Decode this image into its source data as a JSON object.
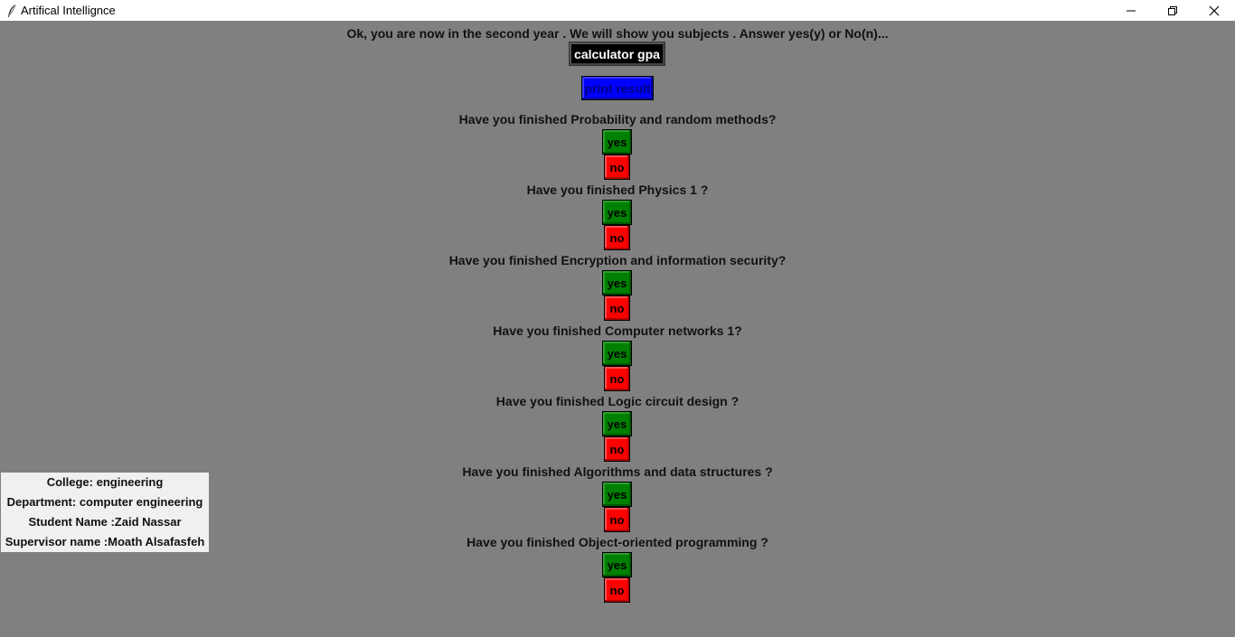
{
  "window": {
    "title": "Artifical Intellignce",
    "app_icon": "feather-icon",
    "controls": [
      "minimize-icon",
      "restore-icon",
      "close-icon"
    ]
  },
  "header": {
    "text": "Ok, you are now in the second year . We will show you subjects . Answer yes(y) or No(n)..."
  },
  "buttons": {
    "calculator": "calculator gpa",
    "print": "print result"
  },
  "questions": [
    {
      "text": "Have you finished Probability and random methods?",
      "yes": "yes",
      "no": "no"
    },
    {
      "text": "Have you finished Physics  1 ?",
      "yes": "yes",
      "no": "no"
    },
    {
      "text": "Have you finished Encryption and information security?",
      "yes": "yes",
      "no": "no"
    },
    {
      "text": "Have you finished Computer networks 1?",
      "yes": "yes",
      "no": "no"
    },
    {
      "text": "Have you finished  Logic circuit design ?",
      "yes": "yes",
      "no": "no"
    },
    {
      "text": "Have you finished Algorithms and data structures ?",
      "yes": "yes",
      "no": "no"
    },
    {
      "text": "Have you finished Object-oriented programming ?",
      "yes": "yes",
      "no": "no"
    }
  ],
  "info": {
    "college": "College: engineering",
    "department": "Department: computer engineering",
    "student": "Student Name :Zaid Nassar",
    "supervisor": "Supervisor name :Moath Alsafasfeh"
  },
  "colors": {
    "background": "#808080",
    "calc_button": "#000000",
    "print_button": "#0000ff",
    "yes_button": "#008000",
    "no_button": "#ff0000",
    "info_panel": "#f0f0f0"
  }
}
